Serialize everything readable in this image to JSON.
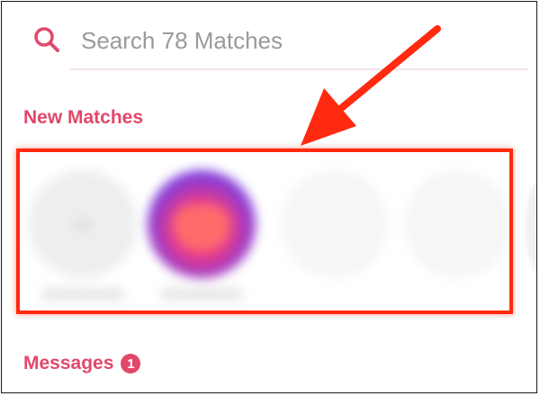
{
  "search": {
    "placeholder": "Search 78 Matches",
    "icon": "search-icon",
    "accent_color": "#e2476a"
  },
  "sections": {
    "new_matches_title": "New Matches",
    "messages_title": "Messages",
    "messages_badge": "1"
  },
  "matches": [
    {
      "name": "",
      "avatar": "placeholder"
    },
    {
      "name": "",
      "avatar": "heart-gradient"
    },
    {
      "name": "",
      "avatar": "empty"
    },
    {
      "name": "",
      "avatar": "empty"
    }
  ],
  "annotation": {
    "highlight_color": "#ff2a10",
    "arrow_color": "#ff2a10"
  }
}
